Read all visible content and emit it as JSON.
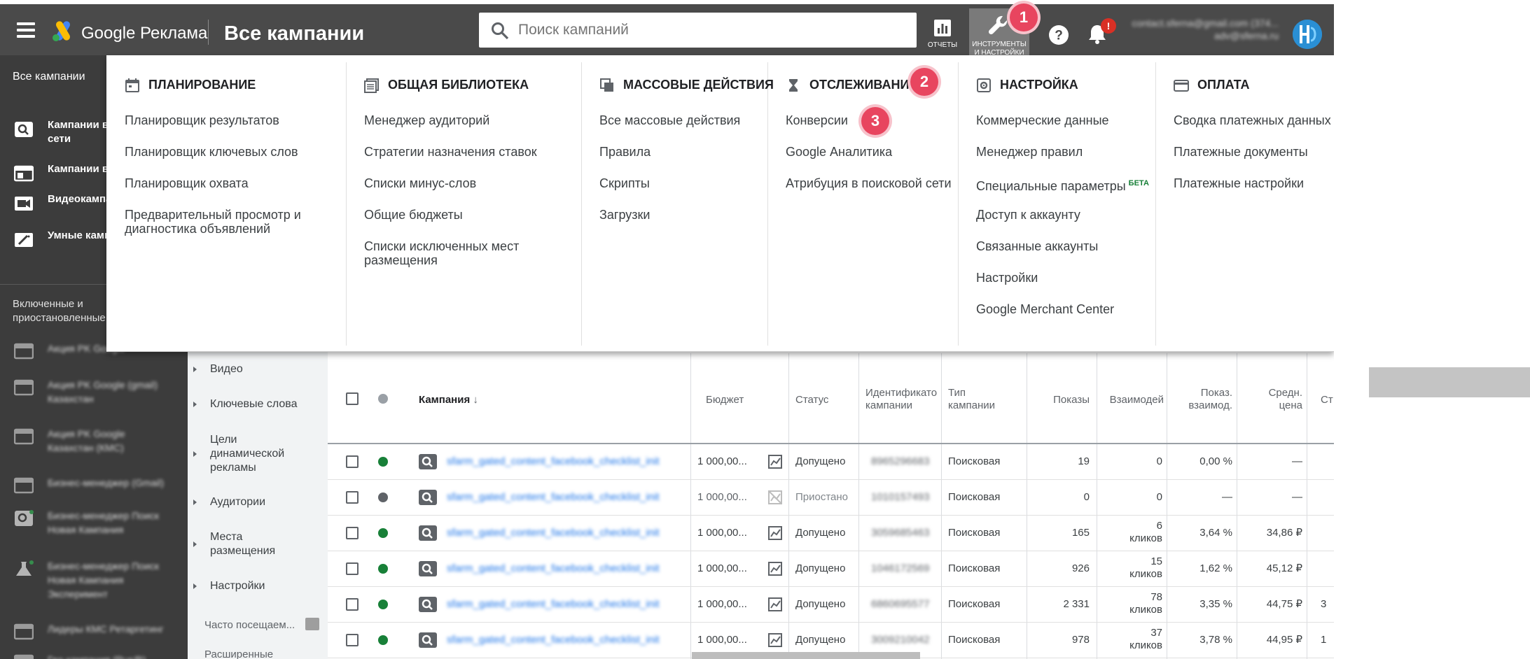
{
  "app": {
    "brand": "Google Реклама",
    "page_title": "Все кампании"
  },
  "search": {
    "placeholder": "Поиск кампаний"
  },
  "toolbar": {
    "reports_label": "ОТЧЕТЫ",
    "tools_label_line1": "ИНСТРУМЕНТЫ",
    "tools_label_line2": "И НАСТРОЙКИ",
    "bell_badge": "!",
    "account_line1": "contact.sferna@gmail.com (374...",
    "account_line2": "adv@sferna.ru"
  },
  "callouts": [
    "1",
    "2",
    "3"
  ],
  "leftnav": {
    "all_campaigns": "Все кампании",
    "items": [
      {
        "label_line1": "Кампании в",
        "label_line2": "сети",
        "icon": "search-campaign-icon"
      },
      {
        "label_line1": "Кампании в",
        "label_line2": "",
        "icon": "display-campaign-icon"
      },
      {
        "label_line1": "Видеокампа",
        "label_line2": "",
        "icon": "video-campaign-icon"
      },
      {
        "label_line1": "Умные камп",
        "label_line2": "",
        "icon": "smart-campaign-icon"
      }
    ],
    "section_line1": "Включенные и",
    "section_line2": "приостановленные",
    "blurred_items": [
      {
        "line1": "Акция PK Google",
        "line2": ""
      },
      {
        "line1": "Акция PK Google (gmail)",
        "line2": "Казахстан"
      },
      {
        "line1": "Акция PK Google",
        "line2": "Казахстан (КМС)"
      },
      {
        "line1": "Бизнес-менеджер (Gmail)",
        "line2": ""
      },
      {
        "line1": "Бизнес-менеджер Поиск",
        "line2": "Новая Кампания"
      },
      {
        "line1": "Бизнес-менеджер Поиск",
        "line2": "Новая Кампания",
        "line3": "Эксперимент"
      },
      {
        "line1": "Лидеры КМС Ретаргетинг",
        "line2": ""
      },
      {
        "line1": "Гео-кампания (Rus/B)",
        "line2": ""
      }
    ]
  },
  "subnav": {
    "items": [
      {
        "line1": "Видео",
        "line2": "",
        "line3": ""
      },
      {
        "line1": "Ключевые слова",
        "line2": "",
        "line3": ""
      },
      {
        "line1": "Цели",
        "line2": "динамической",
        "line3": "рекламы"
      },
      {
        "line1": "Аудитории",
        "line2": "",
        "line3": ""
      },
      {
        "line1": "Места",
        "line2": "размещения",
        "line3": ""
      },
      {
        "line1": "Настройки",
        "line2": "",
        "line3": ""
      }
    ],
    "frequent": "Часто посещаем...",
    "extended": "Расширенные"
  },
  "mega_menu": {
    "columns": [
      {
        "title": "ПЛАНИРОВАНИЕ",
        "icon": "calendar-icon",
        "items": [
          {
            "line1": "Планировщик результатов",
            "line2": ""
          },
          {
            "line1": "Планировщик ключевых слов",
            "line2": ""
          },
          {
            "line1": "Планировщик охвата",
            "line2": ""
          },
          {
            "line1": "Предварительный просмотр и",
            "line2": "диагностика объявлений"
          }
        ]
      },
      {
        "title": "ОБЩАЯ БИБЛИОТЕКА",
        "icon": "library-icon",
        "items": [
          {
            "line1": "Менеджер аудиторий",
            "line2": ""
          },
          {
            "line1": "Стратегии назначения ставок",
            "line2": ""
          },
          {
            "line1": "Списки минус-слов",
            "line2": ""
          },
          {
            "line1": "Общие бюджеты",
            "line2": ""
          },
          {
            "line1": "Списки исключенных мест",
            "line2": "размещения"
          }
        ]
      },
      {
        "title": "МАССОВЫЕ ДЕЙСТВИЯ",
        "icon": "copy-icon",
        "items": [
          {
            "line1": "Все массовые действия",
            "line2": ""
          },
          {
            "line1": "Правила",
            "line2": ""
          },
          {
            "line1": "Скрипты",
            "line2": ""
          },
          {
            "line1": "Загрузки",
            "line2": ""
          }
        ]
      },
      {
        "title": "ОТСЛЕЖИВАНИЕ",
        "icon": "hourglass-icon",
        "items": [
          {
            "line1": "Конверсии",
            "line2": ""
          },
          {
            "line1": "Google Аналитика",
            "line2": ""
          },
          {
            "line1": "Атрибуция в поисковой сети",
            "line2": ""
          }
        ]
      },
      {
        "title": "НАСТРОЙКА",
        "icon": "settings-box-icon",
        "items": [
          {
            "line1": "Коммерческие данные",
            "line2": ""
          },
          {
            "line1": "Менеджер правил",
            "line2": ""
          },
          {
            "line1": "Специальные параметры",
            "line2": "",
            "badge": "БЕТА"
          },
          {
            "line1": "Доступ к аккаунту",
            "line2": ""
          },
          {
            "line1": "Связанные аккаунты",
            "line2": ""
          },
          {
            "line1": "Настройки",
            "line2": ""
          },
          {
            "line1": "Google Merchant Center",
            "line2": ""
          }
        ]
      },
      {
        "title": "ОПЛАТА",
        "icon": "credit-card-icon",
        "items": [
          {
            "line1": "Сводка платежных данных",
            "line2": ""
          },
          {
            "line1": "Платежные документы",
            "line2": ""
          },
          {
            "line1": "Платежные настройки",
            "line2": ""
          }
        ]
      }
    ]
  },
  "table": {
    "headers": {
      "campaign": "Кампания",
      "budget": "Бюджет",
      "status": "Статус",
      "id_line1": "Идентификато",
      "id_line2": "кампании",
      "type_line1": "Тип",
      "type_line2": "кампании",
      "impressions": "Показы",
      "interactions": "Взаимодей",
      "rate_line1": "Показ.",
      "rate_line2": "взаимод.",
      "avg_line1": "Средн.",
      "avg_line2": "цена",
      "cost": "Ст"
    },
    "rows": [
      {
        "name": "sfarm_gated_content_facebook_checklist_init",
        "budget": "1 000,00...",
        "status": "Допущено",
        "status_state": "active",
        "id": "8965296683",
        "type": "Поисковая",
        "impressions": "19",
        "interactions_line1": "0",
        "interactions_line2": "",
        "rate": "0,00 %",
        "avg": "—",
        "cost": ""
      },
      {
        "name": "sfarm_gated_content_facebook_checklist_init",
        "budget": "1 000,00...",
        "status": "Приостано",
        "status_state": "paused",
        "id": "1010157493",
        "type": "Поисковая",
        "impressions": "0",
        "interactions_line1": "0",
        "interactions_line2": "",
        "rate": "—",
        "avg": "—",
        "cost": ""
      },
      {
        "name": "sfarm_gated_content_facebook_checklist_init",
        "budget": "1 000,00...",
        "status": "Допущено",
        "status_state": "active",
        "id": "3059685463",
        "type": "Поисковая",
        "impressions": "165",
        "interactions_line1": "6",
        "interactions_line2": "кликов",
        "rate": "3,64 %",
        "avg": "34,86 ₽",
        "cost": ""
      },
      {
        "name": "sfarm_gated_content_facebook_checklist_init",
        "budget": "1 000,00...",
        "status": "Допущено",
        "status_state": "active",
        "id": "1046172569",
        "type": "Поисковая",
        "impressions": "926",
        "interactions_line1": "15",
        "interactions_line2": "кликов",
        "rate": "1,62 %",
        "avg": "45,12 ₽",
        "cost": ""
      },
      {
        "name": "sfarm_gated_content_facebook_checklist_init",
        "budget": "1 000,00...",
        "status": "Допущено",
        "status_state": "active",
        "id": "6860695577",
        "type": "Поисковая",
        "impressions": "2 331",
        "interactions_line1": "78",
        "interactions_line2": "кликов",
        "rate": "3,35 %",
        "avg": "44,75 ₽",
        "cost": "3"
      },
      {
        "name": "sfarm_gated_content_facebook_checklist_init",
        "budget": "1 000,00...",
        "status": "Допущено",
        "status_state": "active",
        "id": "3009210042",
        "type": "Поисковая",
        "impressions": "978",
        "interactions_line1": "37",
        "interactions_line2": "кликов",
        "rate": "3,78 %",
        "avg": "44,95 ₽",
        "cost": "1"
      }
    ]
  },
  "colors": {
    "topbar": "#4a4a4a",
    "leftnav": "#3c3c3c",
    "callout": "#e8455f",
    "active_status": "#188038",
    "link": "#1a73e8",
    "beta": "#188038"
  }
}
